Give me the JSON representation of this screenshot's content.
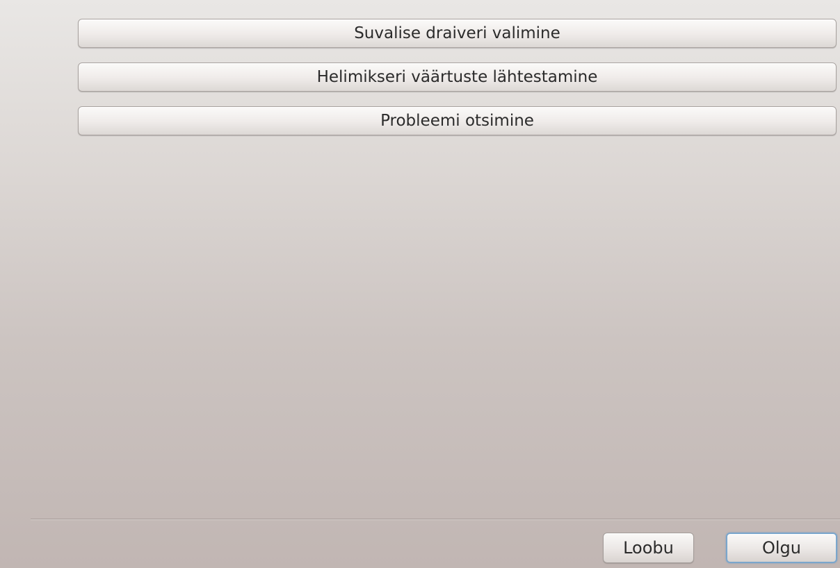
{
  "actions": [
    {
      "label": "Suvalise draiveri valimine"
    },
    {
      "label": "Helimikseri väärtuste lähtestamine"
    },
    {
      "label": "Probleemi otsimine"
    }
  ],
  "footer": {
    "cancel_label": "Loobu",
    "ok_label": "Olgu"
  },
  "colors": {
    "background_top": "#e9e7e5",
    "background_bottom": "#c1b6b3",
    "default_button_focus": "#7aa6cc"
  }
}
